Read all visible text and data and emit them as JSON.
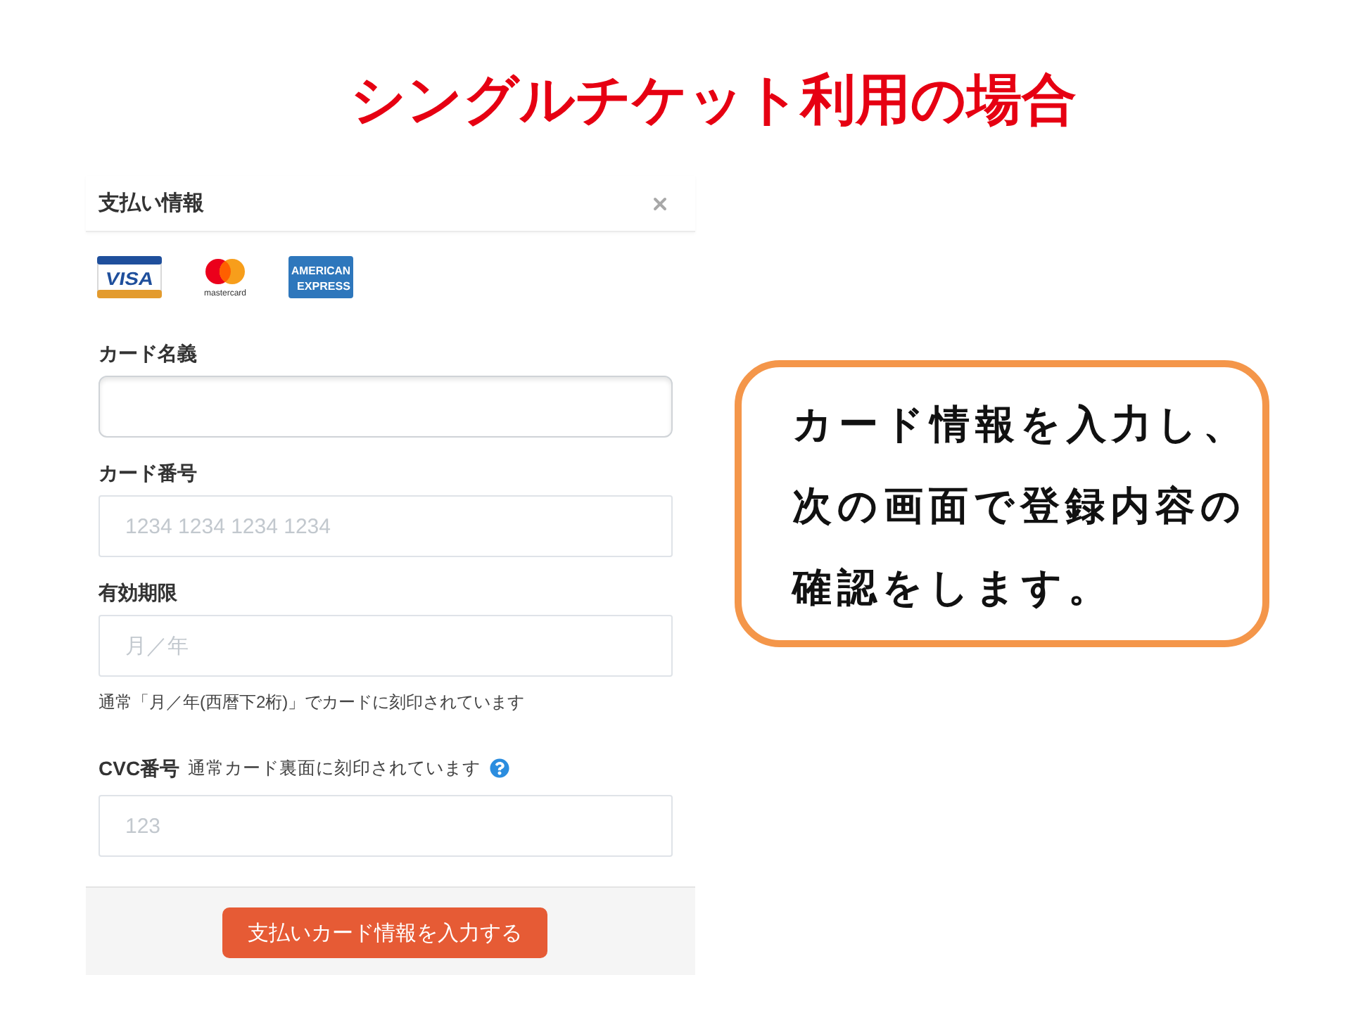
{
  "title": "シングルチケット利用の場合",
  "payment_dialog": {
    "title": "支払い情報",
    "card_brands": [
      {
        "kind": "visa",
        "lines": [
          "VISA"
        ]
      },
      {
        "kind": "mastercard",
        "lines": [
          "mastercard"
        ]
      },
      {
        "kind": "amex",
        "lines": [
          "AMERICAN",
          "EXPRESS"
        ]
      }
    ],
    "fields": [
      {
        "kind": "text",
        "label": "カード名義"
      },
      {
        "kind": "card",
        "label": "カード番号",
        "placeholder": "1234 1234 1234 1234"
      },
      {
        "kind": "card",
        "label": "有効期限",
        "placeholder": "月／年",
        "hint": "通常「月／年(西暦下2桁)」でカードに刻印されています"
      },
      {
        "kind": "card",
        "label": "CVC番号",
        "note": "通常カード裏面に刻印されています",
        "help": true,
        "placeholder": "123"
      }
    ],
    "submit_button": "支払いカード情報を入力する"
  },
  "callout": {
    "text": "カード情報を入力し、次の画面で登録内容の確認をします。"
  }
}
